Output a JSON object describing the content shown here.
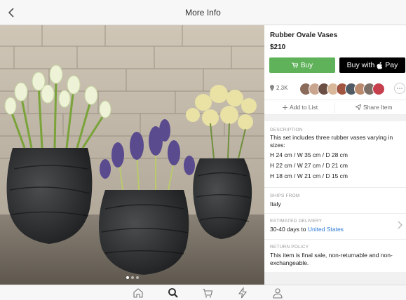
{
  "header": {
    "title": "More Info",
    "back_icon": "chevron-left-icon"
  },
  "carousel": {
    "page_count": 3,
    "active_index": 0
  },
  "product": {
    "title": "Rubber Ovale Vases",
    "price": "$210"
  },
  "buttons": {
    "buy_label": "Buy",
    "buy_icon": "cart-icon",
    "buy_color": "#5fb25a",
    "apple_pay_label": "Buy with",
    "apple_pay_suffix": "Pay",
    "apple_pay_icon": "apple-icon"
  },
  "social": {
    "likes_count": "2.3K",
    "likes_icon": "pin-icon",
    "more_icon": "more-dots-icon"
  },
  "actions": {
    "add_to_list": "Add to List",
    "share_item": "Share Item"
  },
  "details": {
    "description_label": "DESCRIPTION",
    "description_text": "This set includes three rubber vases varying in sizes:",
    "sizes": [
      "H 24 cm / W 35 cm / D 28 cm",
      "H 22 cm / W 27 cm / D 21 cm",
      "H 18 cm / W 21 cm / D 15 cm"
    ],
    "ships_from_label": "SHIPS FROM",
    "ships_from_value": "Italy",
    "delivery_label": "ESTIMATED DELIVERY",
    "delivery_prefix": "30-40 days to",
    "delivery_link": "United States",
    "return_label": "RETURN POLICY",
    "return_text": "This item is final sale, non-returnable and non-exchangeable."
  },
  "tabbar": {
    "items": [
      "home-icon",
      "search-icon",
      "cart-icon",
      "flash-icon",
      "profile-icon"
    ],
    "active": "search-icon"
  },
  "colors": {
    "accent_link": "#2e7bd6",
    "apple_pay_bg": "#000000"
  }
}
